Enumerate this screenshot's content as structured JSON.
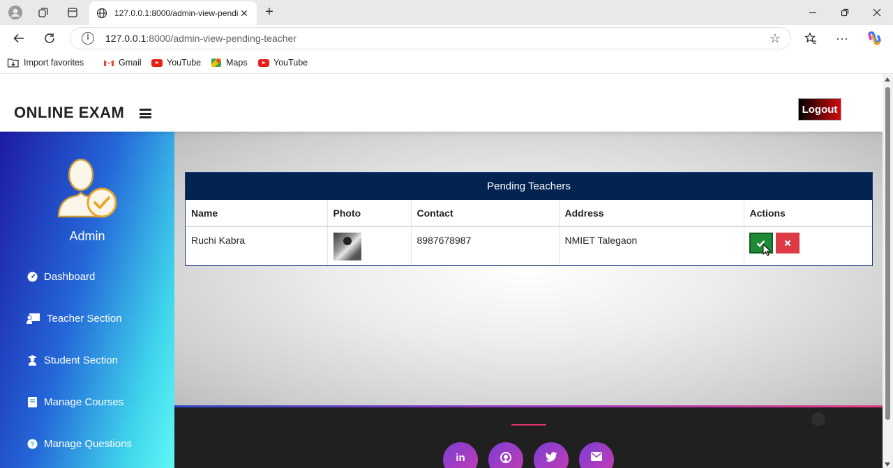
{
  "browser": {
    "tab_title": "127.0.0.1:8000/admin-view-pendi",
    "url_host": "127.0.0.1",
    "url_path": ":8000/admin-view-pending-teacher",
    "bookmarks": [
      "Import favorites",
      "Gmail",
      "YouTube",
      "Maps",
      "YouTube"
    ]
  },
  "header": {
    "brand": "ONLINE EXAM",
    "logout_label": "Logout"
  },
  "sidebar": {
    "admin_name": "Admin",
    "items": [
      {
        "label": "Dashboard",
        "icon": "dashboard-icon"
      },
      {
        "label": "Teacher Section",
        "icon": "teacher-icon"
      },
      {
        "label": "Student Section",
        "icon": "student-icon"
      },
      {
        "label": "Manage Courses",
        "icon": "book-icon"
      },
      {
        "label": "Manage Questions",
        "icon": "question-icon"
      }
    ]
  },
  "table": {
    "title": "Pending Teachers",
    "columns": [
      "Name",
      "Photo",
      "Contact",
      "Address",
      "Actions"
    ],
    "rows": [
      {
        "name": "Ruchi Kabra",
        "contact": "8987678987",
        "address": "NMIET Talegaon"
      }
    ]
  },
  "footer": {
    "social": [
      {
        "label": "in",
        "icon": "linkedin-icon"
      },
      {
        "label": "",
        "icon": "github-icon"
      },
      {
        "label": "",
        "icon": "twitter-icon"
      },
      {
        "label": "",
        "icon": "mail-icon"
      }
    ]
  },
  "colors": {
    "table_header": "#032451",
    "approve": "#1e8a36",
    "reject": "#dc3b45",
    "sidebar_start": "#1e1aa6",
    "sidebar_end": "#61f7f6"
  }
}
